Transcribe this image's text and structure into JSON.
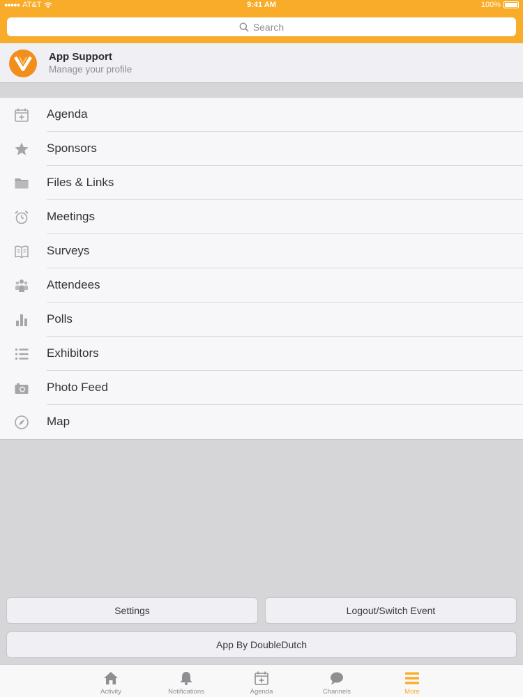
{
  "status_bar": {
    "carrier": "AT&T",
    "time": "9:41 AM",
    "battery": "100%"
  },
  "search": {
    "placeholder": "Search"
  },
  "profile": {
    "title": "App Support",
    "subtitle": "Manage your profile"
  },
  "menu": {
    "items": [
      {
        "label": "Agenda",
        "icon": "calendar-icon"
      },
      {
        "label": "Sponsors",
        "icon": "star-icon"
      },
      {
        "label": "Files & Links",
        "icon": "folder-icon"
      },
      {
        "label": "Meetings",
        "icon": "alarm-clock-icon"
      },
      {
        "label": "Surveys",
        "icon": "book-icon"
      },
      {
        "label": "Attendees",
        "icon": "people-icon"
      },
      {
        "label": "Polls",
        "icon": "bar-chart-icon"
      },
      {
        "label": "Exhibitors",
        "icon": "list-icon"
      },
      {
        "label": "Photo Feed",
        "icon": "camera-icon"
      },
      {
        "label": "Map",
        "icon": "compass-icon"
      }
    ]
  },
  "buttons": {
    "settings": "Settings",
    "logout": "Logout/Switch Event",
    "credit": "App By DoubleDutch"
  },
  "tabs": [
    {
      "label": "Activity",
      "icon": "home-icon"
    },
    {
      "label": "Notifications",
      "icon": "bell-icon"
    },
    {
      "label": "Agenda",
      "icon": "calendar-icon"
    },
    {
      "label": "Channels",
      "icon": "chat-bubble-icon"
    },
    {
      "label": "More",
      "icon": "menu-icon"
    }
  ],
  "colors": {
    "accent": "#f9ac2a",
    "icon_gray": "#a6a6aa"
  }
}
